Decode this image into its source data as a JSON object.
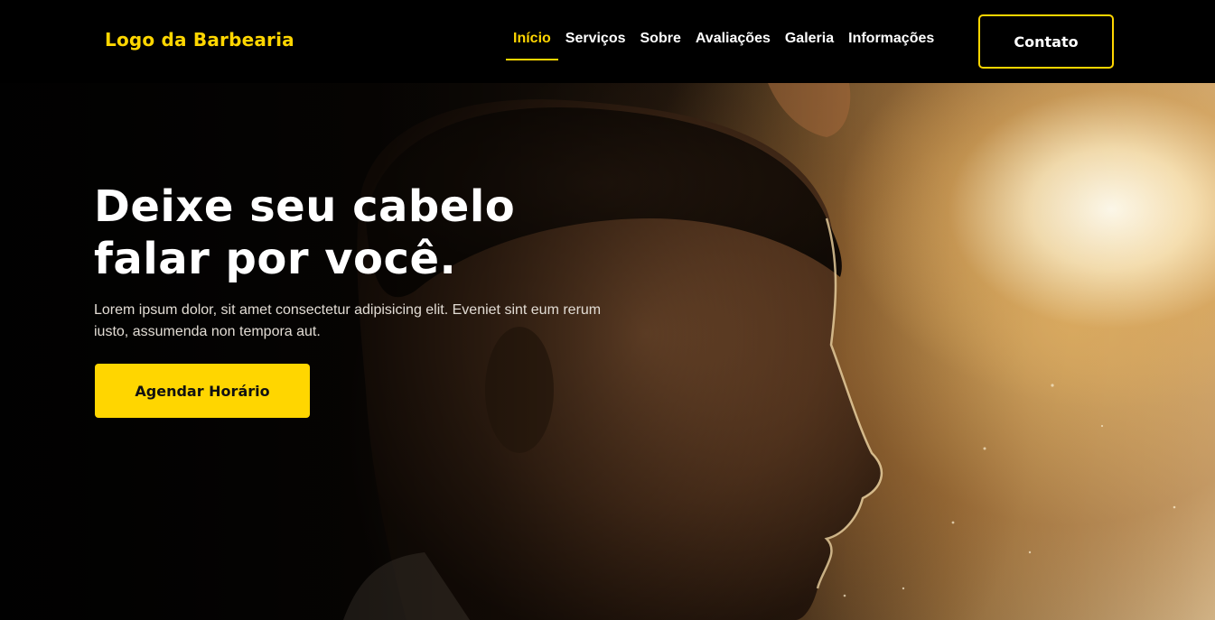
{
  "brand": {
    "logo_text": "Logo da Barbearia"
  },
  "nav": {
    "links": [
      {
        "label": "Início",
        "active": true
      },
      {
        "label": "Serviços",
        "active": false
      },
      {
        "label": "Sobre",
        "active": false
      },
      {
        "label": "Avaliações",
        "active": false
      },
      {
        "label": "Galeria",
        "active": false
      },
      {
        "label": "Informações",
        "active": false
      }
    ],
    "contact_label": "Contato"
  },
  "hero": {
    "title_line1": "Deixe seu cabelo",
    "title_line2": "falar por você.",
    "text": "Lorem ipsum dolor, sit amet consectetur adipisicing elit. Eveniet sint eum rerum iusto, assumenda non tempora aut.",
    "cta_label": "Agendar Horário",
    "image": "barbershop-client-portrait"
  },
  "colors": {
    "accent": "#ffd600",
    "background": "#000000",
    "text": "#ffffff"
  }
}
